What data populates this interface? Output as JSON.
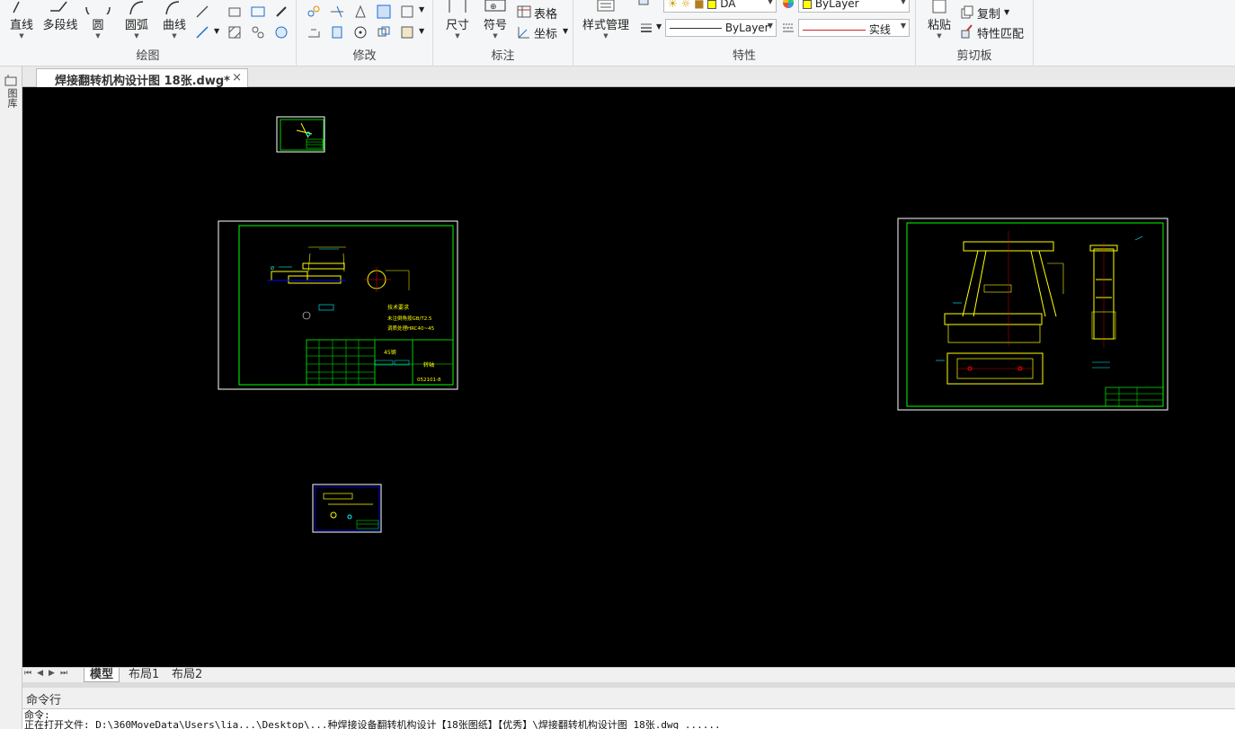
{
  "ribbon": {
    "draw": {
      "label": "绘图",
      "line": "直线",
      "polyline": "多段线",
      "circle": "圆",
      "arc": "圆弧",
      "curve": "曲线"
    },
    "modify": {
      "label": "修改"
    },
    "annotate": {
      "label": "标注",
      "dimension": "尺寸",
      "symbol": "符号",
      "table": "表格",
      "coordinate": "坐标"
    },
    "properties": {
      "label": "特性",
      "style_manager": "样式管理",
      "layer_name": "DA",
      "color_value": "ByLayer",
      "linetype_value": "ByLayer",
      "lineweight_value": "实线"
    },
    "clipboard": {
      "label": "剪切板",
      "paste": "粘贴",
      "copy": "复制",
      "match_props": "特性匹配"
    }
  },
  "document_tab": {
    "title": "焊接翻转机构设计图 18张.dwg*",
    "close": "×"
  },
  "side_panel": {
    "label": "图库"
  },
  "layout_tabs": [
    "模型",
    "布局1",
    "布局2"
  ],
  "command": {
    "header": "命令行",
    "lines": [
      "命令:",
      "正在打开文件: D:\\360MoveData\\Users\\lia...\\Desktop\\...种焊接设备翻转机构设计【18张图纸】【优秀】\\焊接翻转机构设计图 18张.dwg ......"
    ]
  },
  "drawing_texts": {
    "tech_note_1": "技术要求",
    "tech_note_2": "未注倒角按GB/T2.5",
    "tech_note_3": "调质处理HRC40~45",
    "material": "45钢",
    "part_name": "转轴",
    "drawing_code": "052101-8"
  },
  "colors": {
    "canvas": "#000000",
    "border_white": "#ffffff",
    "frame_green": "#00ff00",
    "geometry_yellow": "#ffff00",
    "dim_cyan": "#00ffff",
    "center_blue": "#0000ff",
    "center_red": "#ff0000",
    "title_block_green": "#00ff00"
  }
}
